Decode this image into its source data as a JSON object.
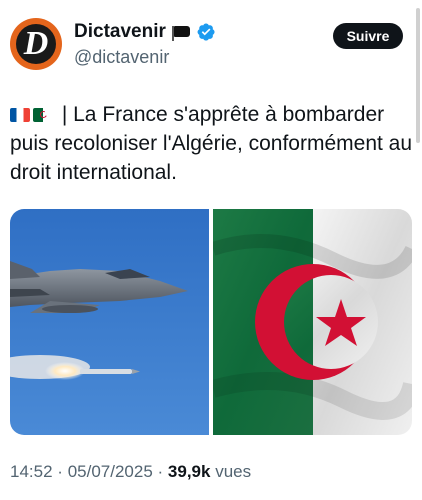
{
  "author": {
    "display_name": "Dictavenir",
    "handle": "@dictavenir",
    "avatar_letter": "D",
    "name_emoji": "black-flag-icon",
    "verified": true
  },
  "follow_button": {
    "label": "Suivre"
  },
  "tweet": {
    "text": " | La France s'apprête à bombarder puis recoloniser l'Algérie, conformément au droit international.",
    "flags": [
      "france-flag-icon",
      "algeria-flag-icon"
    ]
  },
  "media": [
    {
      "name": "fighter-jet-missile-photo"
    },
    {
      "name": "algeria-flag-photo"
    }
  ],
  "meta": {
    "time": "14:52",
    "date": "05/07/2025",
    "separator": "·",
    "views_count": "39,9k",
    "views_label": "vues"
  },
  "colors": {
    "brand_avatar": "#e4651c",
    "verified_blue": "#1d9bf0",
    "sky": "#3b79c9",
    "algeria_green": "#006233",
    "algeria_red": "#d21034"
  }
}
